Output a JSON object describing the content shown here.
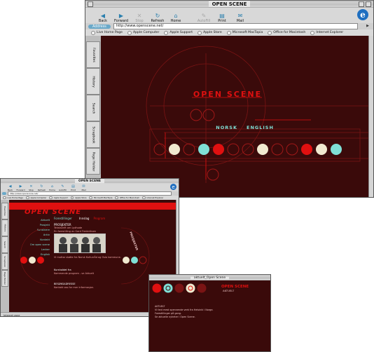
{
  "main_window": {
    "title": "OPEN SCENE",
    "toolbar": [
      {
        "label": "Back",
        "icon": "back-arrow-icon",
        "enabled": true
      },
      {
        "label": "Forward",
        "icon": "forward-arrow-icon",
        "enabled": true
      },
      {
        "label": "Stop",
        "icon": "stop-icon",
        "enabled": false
      },
      {
        "label": "Refresh",
        "icon": "refresh-icon",
        "enabled": true
      },
      {
        "label": "Home",
        "icon": "home-icon",
        "enabled": true
      },
      {
        "label": "AutoFill",
        "icon": "autofill-icon",
        "enabled": false
      },
      {
        "label": "Print",
        "icon": "print-icon",
        "enabled": true
      },
      {
        "label": "Mail",
        "icon": "mail-icon",
        "enabled": true
      }
    ],
    "address_label": "Address",
    "address_value": "http://www.openscene.net/",
    "favorites": [
      "Live Home Page",
      "Apple Computer",
      "Apple Support",
      "Apple Store",
      "Microsoft MacTopia",
      "Office for Macintosh",
      "Internet Explorer"
    ],
    "side_tabs": [
      "Favorites",
      "History",
      "Search",
      "Scrapbook",
      "Page Holder"
    ],
    "site": {
      "logo": "OPEN SCENE",
      "lang_1": "NORSK",
      "lang_2": "ENGLISH"
    }
  },
  "second_window": {
    "title": "OPEN SCENE",
    "toolbar": [
      "Back",
      "Forward",
      "Stop",
      "Refresh",
      "Home",
      "AutoFill",
      "Print",
      "Mail"
    ],
    "address_value": "http://www.openscene.net/",
    "favorites": [
      "Live Home Page",
      "Apple Computer",
      "Apple Support",
      "Apple Store",
      "Microsoft MacTopia",
      "Office for Macintosh",
      "Internet Explorer"
    ],
    "side_tabs": [
      "Favorites",
      "History",
      "Search",
      "Scrapbook",
      "Page Holder"
    ],
    "status": "Internet zone",
    "site": {
      "logo": "OPEN SCENE",
      "menu": [
        "Aktuelt",
        "Prosjekt",
        "Kunstnere",
        "Arkiv",
        "Kontakt",
        "Om open scene",
        "Lenker",
        "English"
      ],
      "sub_nav": "Forestillinger",
      "tab_1": "Innslag",
      "tab_2": "Program",
      "heading": "PROSJEKTER",
      "vertical_word": "PROSJEKTER",
      "para_1_title": "Tekstskrift om Lydhode",
      "para_1": "En forestilling av Gard Frederiksen",
      "para_2": "Vi mottar støtte fra Norsk Kulturråd og Oslo kommune.",
      "para_3_title": "Kursholdet fra",
      "para_3": "Kommende program - se Aktuelt",
      "para_4_title": "BESØKSADRESSE",
      "para_4": "Kontakt oss for mer informasjon."
    }
  },
  "popup_window": {
    "title": "aktuelt_Open Scene",
    "heading_1": "OPEN SCENE",
    "heading_2": "AKTUELT",
    "body_lines": [
      "AKTUELT",
      "Vi fant mest spennende verk fra Helsinki i Norge.",
      "Forestillinger på gang.",
      "Se aktuelle nyheter i Open Scene."
    ]
  },
  "colors": {
    "bg_dark": "#3a0a0a",
    "accent_red": "#e01010",
    "teal": "#7fe0d6",
    "cream": "#f1ead0",
    "address_pill": "#6aa9c9"
  }
}
